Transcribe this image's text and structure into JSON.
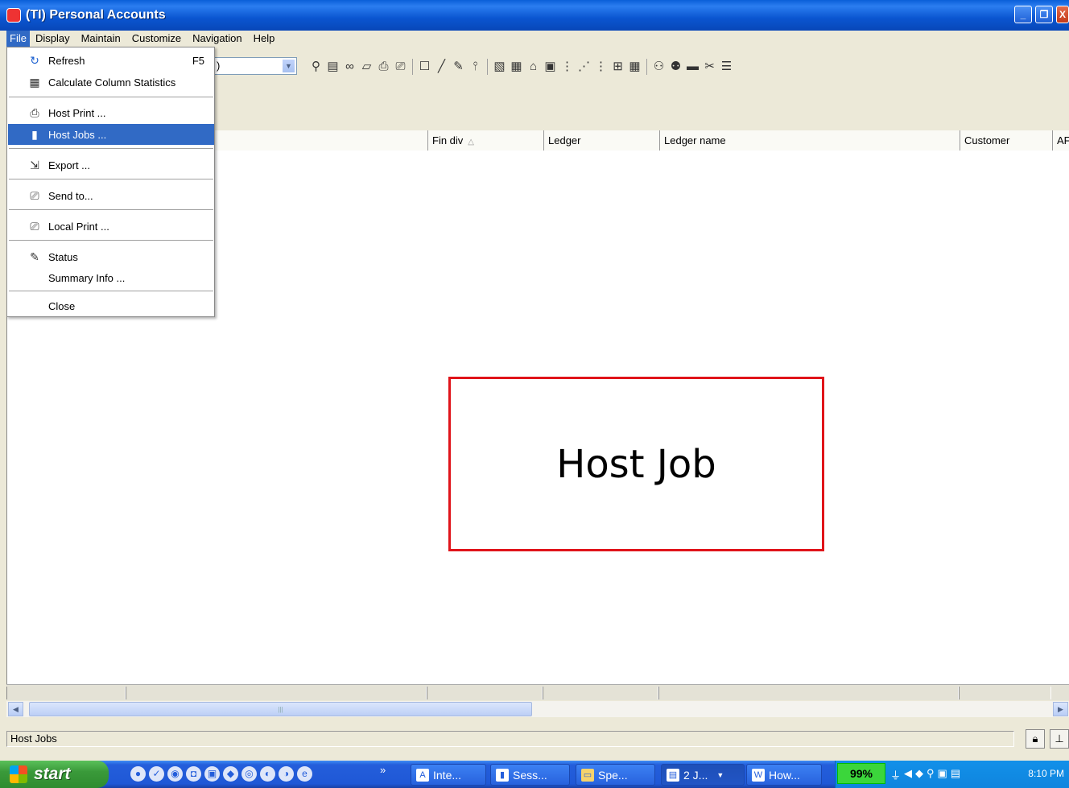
{
  "window": {
    "title": "(TI) Personal Accounts"
  },
  "menubar": {
    "items": [
      "File",
      "Display",
      "Maintain",
      "Customize",
      "Navigation",
      "Help"
    ]
  },
  "toolbar": {
    "combo_value": ")"
  },
  "grid": {
    "columns": [
      {
        "label": "Fin div"
      },
      {
        "label": "Ledger"
      },
      {
        "label": "Ledger name"
      },
      {
        "label": "Customer"
      },
      {
        "label": "AF"
      }
    ]
  },
  "file_menu": {
    "items": [
      {
        "label": "Refresh",
        "shortcut": "F5",
        "icon": "refresh-icon"
      },
      {
        "label": "Calculate Column Statistics",
        "icon": "statistics-icon"
      },
      {
        "label": "Host Print ...",
        "icon": "host-print-icon"
      },
      {
        "label": "Host Jobs ...",
        "icon": "host-jobs-icon"
      },
      {
        "label": "Export ...",
        "icon": "export-icon"
      },
      {
        "label": "Send to...",
        "icon": "send-to-icon"
      },
      {
        "label": "Local Print ...",
        "icon": "local-print-icon"
      },
      {
        "label": "Status",
        "icon": "status-icon"
      },
      {
        "label": "Summary Info ...",
        "icon": ""
      },
      {
        "label": "Close",
        "icon": ""
      }
    ]
  },
  "annotation": {
    "text": "Host Job",
    "color": "#e0141a"
  },
  "statusbar": {
    "text": "Host Jobs"
  },
  "taskbar": {
    "start_label": "start",
    "buttons": [
      "Inte...",
      "Sess...",
      "Spe...",
      "2 J...",
      "How..."
    ],
    "battery": "99%",
    "clock": "8:10 PM"
  },
  "colors": {
    "selection": "#316ac5",
    "titlebar": "#0a55d0"
  }
}
